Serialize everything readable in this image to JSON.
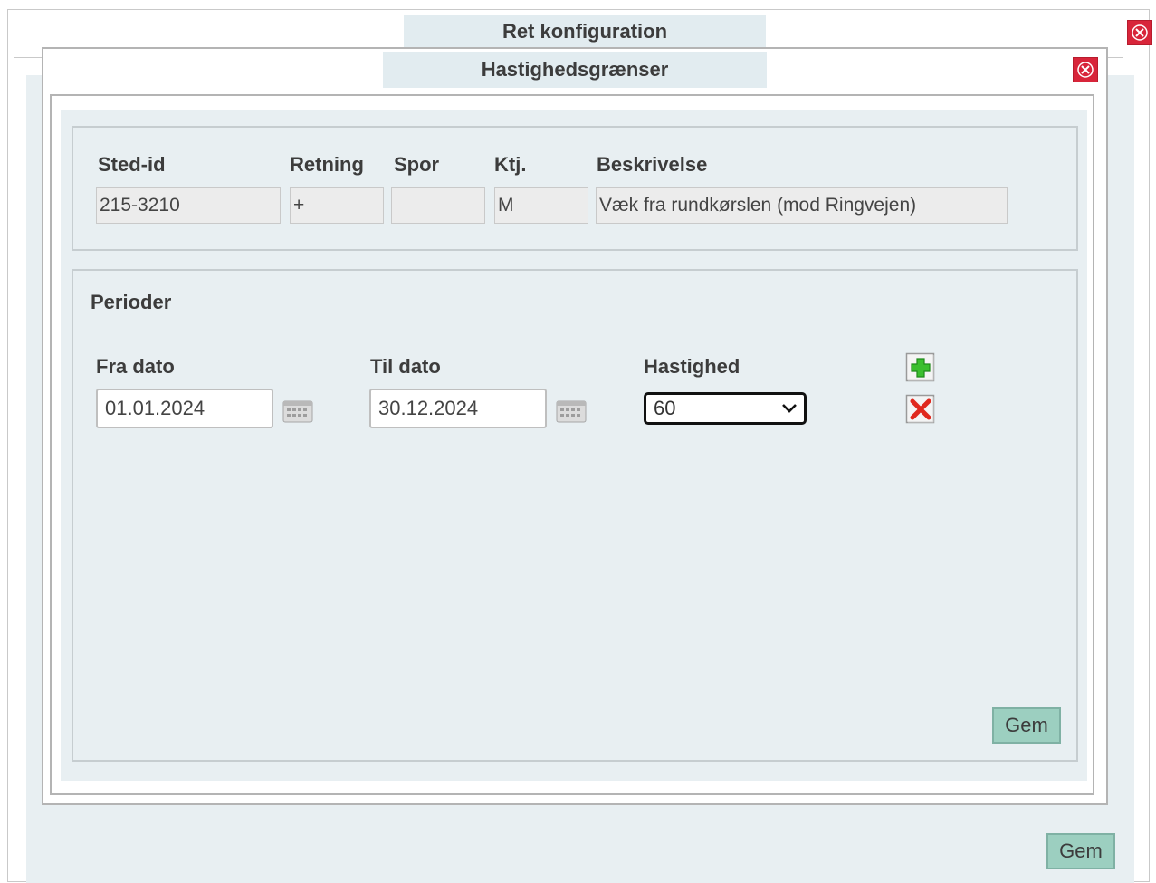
{
  "outer_dialog": {
    "title": "Ret konfiguration",
    "save_label": "Gem"
  },
  "inner_dialog": {
    "title": "Hastighedsgrænser",
    "info": {
      "headers": {
        "sted_id": "Sted-id",
        "retning": "Retning",
        "spor": "Spor",
        "ktj": "Ktj.",
        "beskrivelse": "Beskrivelse"
      },
      "values": {
        "sted_id": "215-3210",
        "retning": "+",
        "spor": "",
        "ktj": "M",
        "beskrivelse": "Væk fra rundkørslen (mod Ringvejen)"
      }
    },
    "periods": {
      "title": "Perioder",
      "headers": {
        "from_date": "Fra dato",
        "to_date": "Til dato",
        "speed": "Hastighed"
      },
      "rows": [
        {
          "from_date": "01.01.2024",
          "to_date": "30.12.2024",
          "speed": "60"
        }
      ],
      "save_label": "Gem"
    }
  },
  "icons": {
    "close": "close-icon",
    "calendar": "calendar-icon",
    "add": "add-icon",
    "delete": "delete-icon",
    "dropdown": "chevron-down-icon"
  },
  "colors": {
    "panel_bg": "#e8eff2",
    "title_bg": "#e2ecf0",
    "close_red": "#d8253a",
    "save_green": "#9ccfc0"
  }
}
